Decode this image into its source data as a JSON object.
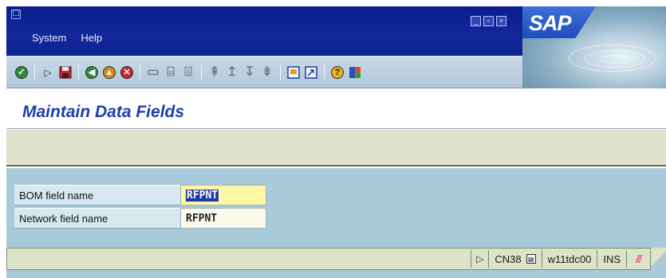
{
  "menu": {
    "system": "System",
    "help": "Help"
  },
  "logo": {
    "text": "SAP"
  },
  "title": "Maintain Data Fields",
  "fields": [
    {
      "label": "BOM field name",
      "value": "RFPNT"
    },
    {
      "label": "Network field name",
      "value": "RFPNT"
    }
  ],
  "status": {
    "transaction": "CN38",
    "server": "w11tdc00",
    "mode": "INS"
  },
  "colors": {
    "titlebar": "#0d2290",
    "title_text": "#1d3fb0",
    "main_bg": "#a9cad8",
    "active_field": "#fff7a6"
  },
  "toolbar_icons": [
    "enter-icon",
    "command-field-icon",
    "save-icon",
    "back-icon",
    "exit-icon",
    "cancel-icon",
    "print-icon",
    "find-icon",
    "find-next-icon",
    "first-page-icon",
    "previous-page-icon",
    "next-page-icon",
    "last-page-icon",
    "create-session-icon",
    "create-shortcut-icon",
    "help-icon",
    "customize-layout-icon"
  ]
}
